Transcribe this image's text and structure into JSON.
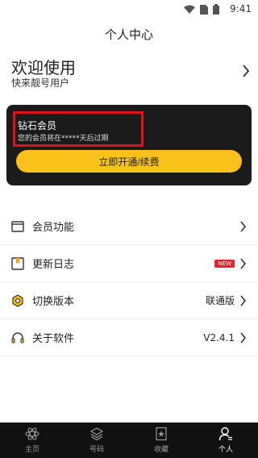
{
  "statusbar": {
    "time": "9:41"
  },
  "header": {
    "title": "个人中心"
  },
  "welcome": {
    "title": "欢迎使用",
    "subtitle": "快来靓号用户"
  },
  "vip": {
    "title": "钻石会员",
    "subtitle": "您的会员将在*****天后过期",
    "button": "立即开通/续费"
  },
  "menu": [
    {
      "label": "会员功能",
      "icon": "card-icon",
      "right": ""
    },
    {
      "label": "更新日志",
      "icon": "log-icon",
      "right": "",
      "badge": "NEW"
    },
    {
      "label": "切换版本",
      "icon": "hex-nut-icon",
      "right": "联通版"
    },
    {
      "label": "关于软件",
      "icon": "headset-icon",
      "right": "V2.4.1"
    }
  ],
  "tabs": [
    {
      "label": "主页",
      "icon": "atom-icon",
      "active": false
    },
    {
      "label": "号码",
      "icon": "layers-icon",
      "active": false
    },
    {
      "label": "收藏",
      "icon": "star-icon",
      "active": false
    },
    {
      "label": "个人",
      "icon": "person-icon",
      "active": true
    }
  ],
  "colors": {
    "accent": "#f8c21a",
    "card": "#1b1b1b",
    "highlight": "#e0131b",
    "tabbar": "#111111"
  }
}
